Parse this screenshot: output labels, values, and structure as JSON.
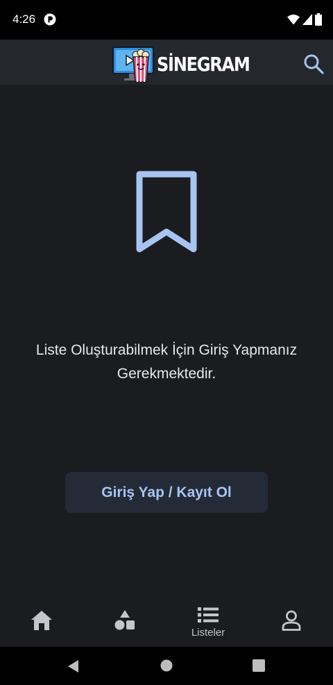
{
  "status_bar": {
    "time": "4:26"
  },
  "app_bar": {
    "logo_text": "SİNEGRAM"
  },
  "main": {
    "message": "Liste Oluşturabilmek İçin Giriş Yapmanız Gerekmektedir.",
    "login_button_label": "Giriş Yap / Kayıt Ol"
  },
  "bottom_nav": {
    "items": [
      {
        "icon": "home-icon",
        "label": ""
      },
      {
        "icon": "categories-icon",
        "label": ""
      },
      {
        "icon": "list-icon",
        "label": "Listeler",
        "active": true
      },
      {
        "icon": "profile-icon",
        "label": ""
      }
    ]
  },
  "colors": {
    "background": "#1b1c1f",
    "app_bar": "#24272c",
    "accent": "#a8c4f2",
    "button_bg": "#242b37"
  }
}
